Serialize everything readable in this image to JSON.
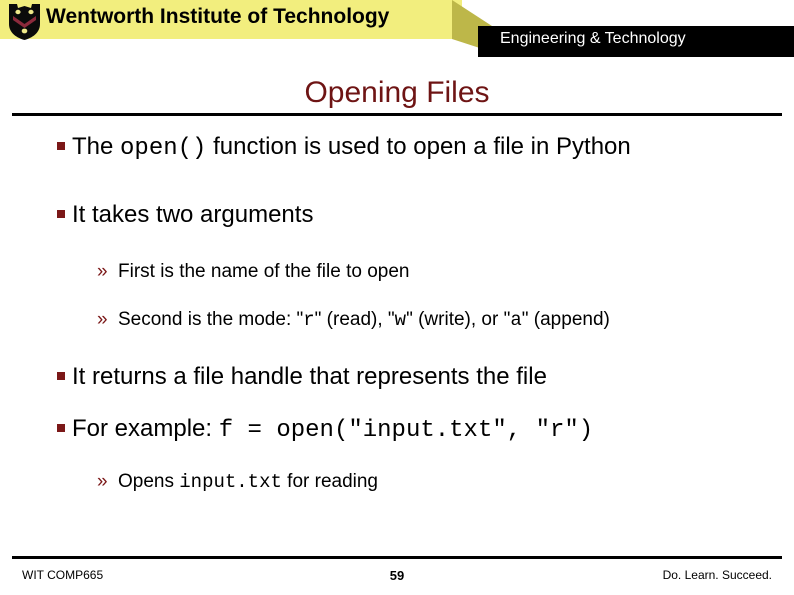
{
  "header": {
    "logo_icon": "wit-shield-logo-icon",
    "institution": "Wentworth Institute of Technology",
    "department": "Engineering & Technology",
    "banner_yellow_color": "#f2ee7e",
    "banner_wedge_color": "#bdb749",
    "banner_black_color": "#000000"
  },
  "slide": {
    "title": "Opening Files",
    "title_color": "#6e1414",
    "bullet_color": "#7b1818",
    "bullets": [
      {
        "level": 1,
        "marker": "square-bullet",
        "parts": [
          {
            "text": "The ",
            "mono": false
          },
          {
            "text": "open()",
            "mono": true
          },
          {
            "text": " function is used to open a file in Python",
            "mono": false
          }
        ]
      },
      {
        "level": 1,
        "marker": "square-bullet",
        "parts": [
          {
            "text": "It takes two arguments",
            "mono": false
          }
        ]
      },
      {
        "level": 2,
        "marker": "guillemet-bullet",
        "parts": [
          {
            "text": "First is the name of the file to open",
            "mono": false
          }
        ]
      },
      {
        "level": 2,
        "marker": "guillemet-bullet",
        "parts": [
          {
            "text": "Second is the mode: \"",
            "mono": false
          },
          {
            "text": "r",
            "mono": true
          },
          {
            "text": "\" (read), \"",
            "mono": false
          },
          {
            "text": "w",
            "mono": true
          },
          {
            "text": "\" (write), or \"",
            "mono": false
          },
          {
            "text": "a",
            "mono": true
          },
          {
            "text": "\" (append)",
            "mono": false
          }
        ]
      },
      {
        "level": 1,
        "marker": "square-bullet",
        "parts": [
          {
            "text": "It returns a file handle that represents the file",
            "mono": false
          }
        ]
      },
      {
        "level": 1,
        "marker": "square-bullet",
        "parts": [
          {
            "text": "For example: ",
            "mono": false
          },
          {
            "text": "f = open(\"input.txt\", \"r\")",
            "mono": true
          }
        ]
      },
      {
        "level": 2,
        "marker": "guillemet-bullet",
        "parts": [
          {
            "text": "Opens ",
            "mono": false
          },
          {
            "text": "input.txt",
            "mono": true
          },
          {
            "text": " for reading",
            "mono": false
          }
        ]
      }
    ],
    "level2_marker_glyph": "»"
  },
  "footer": {
    "course": "WIT COMP665",
    "page_number": "59",
    "tagline": "Do. Learn. Succeed."
  }
}
